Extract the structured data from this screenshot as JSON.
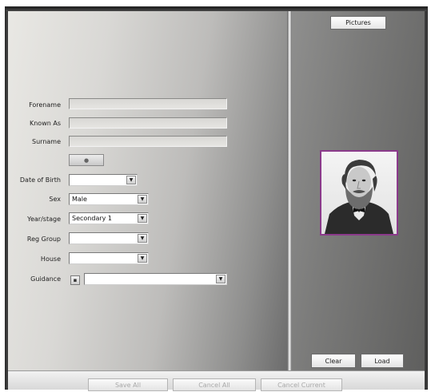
{
  "tabs": {
    "pictures": "Pictures"
  },
  "form": {
    "forename_label": "Forename",
    "known_as_label": "Known As",
    "surname_label": "Surname",
    "date_of_birth_label": "Date of Birth",
    "sex_label": "Sex",
    "sex_value": "Male",
    "year_stage_label": "Year/stage",
    "year_stage_value": "Secondary 1",
    "reg_group_label": "Reg Group",
    "house_label": "House",
    "guidance_label": "Guidance"
  },
  "pictures": {
    "clear_label": "Clear",
    "load_label": "Load"
  },
  "bottom_bar": {
    "save_all": "Save All",
    "cancel_all": "Cancel All",
    "cancel_current": "Cancel Current"
  },
  "icons": {
    "dropdown": "chevron-down-icon",
    "guidance_toggle": "plus-icon",
    "small_button": "dot-icon"
  },
  "colors": {
    "photo_border": "#8b3a8b",
    "disabled_text": "#a8a8a8"
  }
}
